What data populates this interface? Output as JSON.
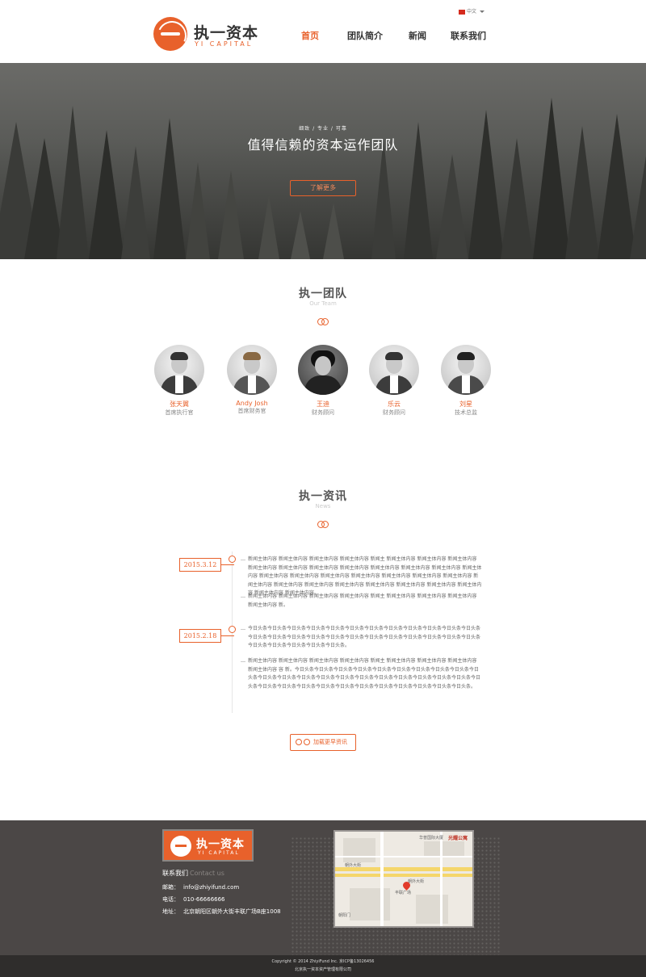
{
  "header": {
    "logo_cn": "执一资本",
    "logo_en": "YI CAPITAL",
    "language": "中文",
    "nav": [
      {
        "label": "首页",
        "active": true
      },
      {
        "label": "团队简介",
        "active": false
      },
      {
        "label": "新闻",
        "active": false
      },
      {
        "label": "联系我们",
        "active": false
      }
    ]
  },
  "hero": {
    "tagline": "细致 / 专业 / 可靠",
    "title": "值得信赖的资本运作团队",
    "button": "了解更多"
  },
  "team": {
    "title": "执一团队",
    "subtitle": "Our Team",
    "members": [
      {
        "name": "张天翼",
        "role": "首席执行官"
      },
      {
        "name": "Andy Josh",
        "role": "首席财务官"
      },
      {
        "name": "王迪",
        "role": "财务顾问"
      },
      {
        "name": "乐云",
        "role": "财务顾问"
      },
      {
        "name": "刘星",
        "role": "技术总监"
      }
    ]
  },
  "news": {
    "title": "执一资讯",
    "subtitle": "News",
    "items": [
      {
        "date": "2015.3.12",
        "paragraphs": [
          "新闻主体内容 新闻主体内容 新闻主体内容 新闻主体内容 新闻主 新闻主体内容 新闻主体内容 新闻主体内容 新闻主体内容 新闻主体内容 新闻主体内容 新闻主体内容 新闻主体内容 新闻主体内容 新闻主体内容 新闻主体内容 新闻主体内容 新闻主体内容 新闻主体内容 新闻主体内容 新闻主体内容 新闻主体内容 新闻主体内容 新闻主体内容 新闻主体内容 新闻主体内容 新闻主体内容 新闻主体内容 新闻主体内容 新闻主体内容 新闻主体内容 新闻主体内容 新闻主体内容。",
          "新闻主体内容 新闻主体内容 新闻主体内容 新闻主体内容 新闻主 新闻主体内容 新闻主体内容 新闻主体内容 新闻主体内容 新。"
        ]
      },
      {
        "date": "2015.2.18",
        "paragraphs": [
          "今日头条今日头条今日头条今日头条今日头条今日头条今日头条今日头条今日头条今日头条今日头条今日头条今日头条今日头条今日头条今日头条今日头条今日头条今日头条今日头条今日头条今日头条今日头条今日头条今日头条今日头条今日头条今日头条今日头条。",
          "新闻主体内容 新闻主体内容 新闻主体内容 新闻主体内容 新闻主 新闻主体内容 新闻主体内容 新闻主体内容 新闻主体内容 容 新。今日头条今日头条今日头条今日头条今日头条今日头条今日头条今日头条今日头条今日头条今日头条今日头条今日头条今日头条今日头条今日头条今日头条今日头条今日头条今日头条今日头条今日头条今日头条今日头条今日头条今日头条今日头条今日头条今日头条今日头条今日头条今日头条今日头条。"
        ]
      }
    ],
    "more_button": "加载更早资讯"
  },
  "footer": {
    "logo_cn": "执一资本",
    "logo_en": "YI CAPITAL",
    "contact_title": "联系我们",
    "contact_title_en": "Contact us",
    "email_label": "邮箱：",
    "email": "info@zhiyifund.com",
    "phone_label": "电话：",
    "phone": "010-66666666",
    "address_label": "地址：",
    "address": "北京朝阳区朝外大街丰联广场B座1008",
    "map_labels": [
      "光耀公寓",
      "华普国际大厦",
      "朝外大街",
      "朝外大街",
      "丰联广场",
      "朝阳门"
    ],
    "copyright": "Copyright © 2014 ZhiyiFund Inc.  京ICP备13026456",
    "company": "北京执一资本资产管理有限公司"
  },
  "colors": {
    "accent": "#e8612b",
    "footer_bg": "#4b4746",
    "bottom_bg": "#2f2d2c"
  }
}
